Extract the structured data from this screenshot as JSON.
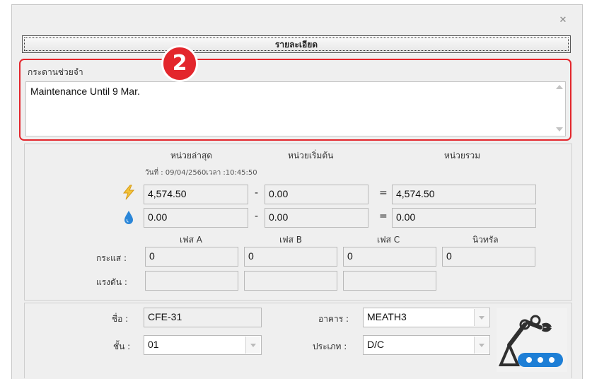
{
  "window": {
    "close_icon": "close-icon"
  },
  "header": {
    "title": "รายละเอียด"
  },
  "memo": {
    "badge": "2",
    "label": "กระดานช่วยจำ",
    "text": "Maintenance Until 9 Mar."
  },
  "meter": {
    "col_latest": "หน่วยล่าสุด",
    "col_start": "หน่วยเริ่มต้น",
    "col_total": "หน่วยรวม",
    "timestamp": "วันที่ : 09/04/2560เวลา :10:45:50",
    "electric": {
      "icon": "lightning-icon",
      "latest": "4,574.50",
      "minus": "-",
      "start": "0.00",
      "equals": "=",
      "total": "4,574.50"
    },
    "water": {
      "icon": "water-drop-icon",
      "latest": "0.00",
      "minus": "-",
      "start": "0.00",
      "equals": "=",
      "total": "0.00"
    }
  },
  "phases": {
    "phase_a": "เฟส A",
    "phase_b": "เฟส B",
    "phase_c": "เฟส C",
    "neutral": "นิวทรัล",
    "current_label": "กระแส :",
    "voltage_label": "แรงดัน :",
    "current": [
      "0",
      "0",
      "0",
      "0"
    ],
    "voltage": [
      "",
      "",
      ""
    ]
  },
  "info": {
    "name_label": "ชื่อ :",
    "name_value": "CFE-31",
    "floor_label": "ชั้น :",
    "floor_value": "01",
    "building_label": "อาคาร :",
    "building_value": "MEATH3",
    "type_label": "ประเภท :",
    "type_value": "D/C",
    "device_icon": "robot-conveyor-icon"
  },
  "colors": {
    "highlight": "#e3262c",
    "bolt": "#f3c33a",
    "drop": "#2a86d8",
    "robot_dark": "#2f2f2f",
    "robot_blue": "#1e7fd6"
  }
}
